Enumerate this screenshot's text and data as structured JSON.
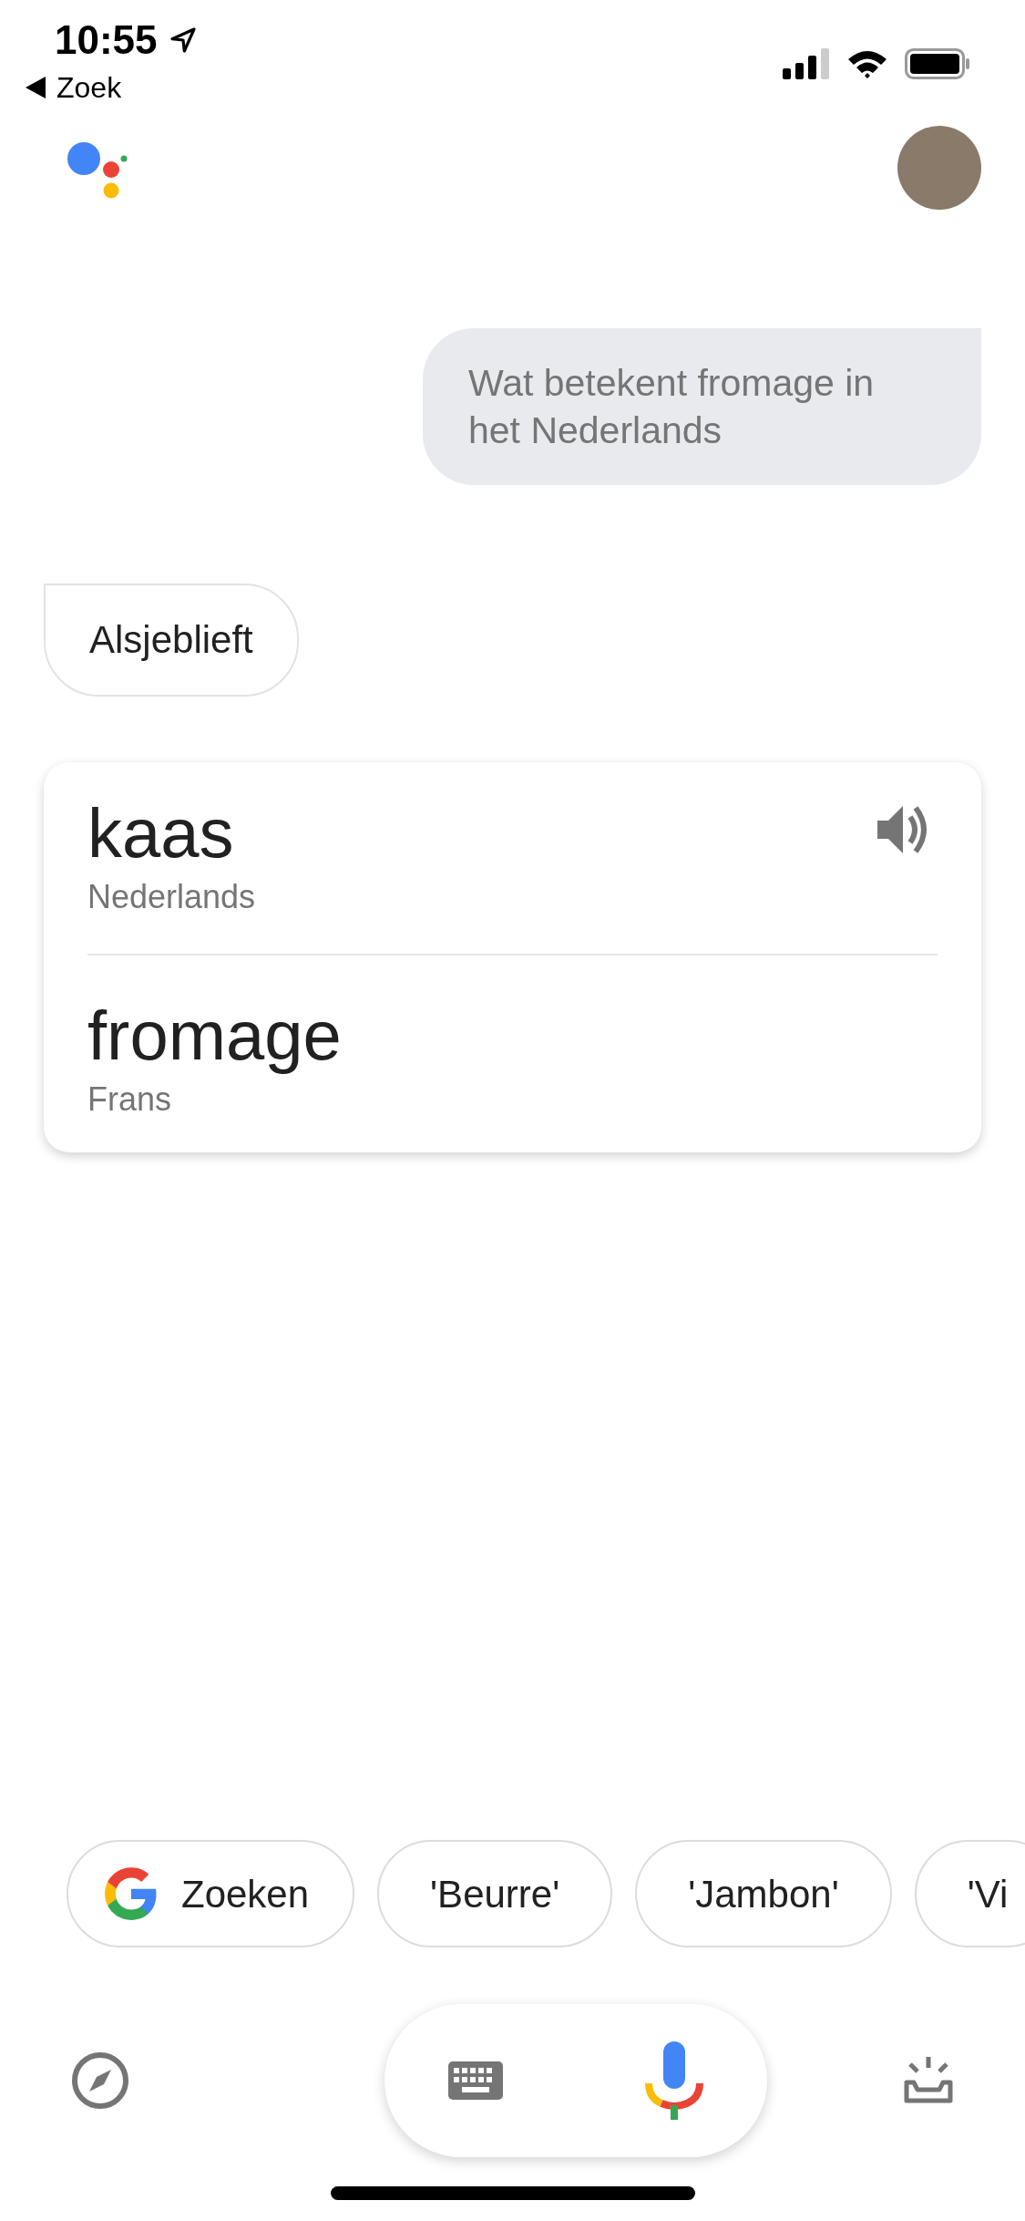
{
  "status_bar": {
    "time": "10:55",
    "back_label": "Zoek"
  },
  "conversation": [
    {
      "kind": "user",
      "text": "Wat betekent fromage in het Nederlands"
    },
    {
      "kind": "assistant",
      "text": "Alsjeblieft"
    }
  ],
  "translation_card": {
    "entries": [
      {
        "word": "kaas",
        "language": "Nederlands",
        "speaker": true
      },
      {
        "word": "fromage",
        "language": "Frans",
        "speaker": false
      }
    ]
  },
  "suggestion_chips": [
    {
      "kind": "search",
      "label": "Zoeken"
    },
    {
      "kind": "text",
      "label": "'Beurre'"
    },
    {
      "kind": "text",
      "label": "'Jambon'"
    },
    {
      "kind": "text",
      "label": "'Vi"
    }
  ]
}
